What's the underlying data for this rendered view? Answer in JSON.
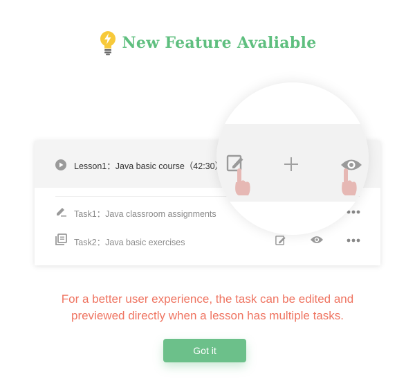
{
  "dialog": {
    "title": "New Feature Avaliable",
    "accent_color": "#5fbf7f",
    "title_icon": "lightbulb-icon"
  },
  "course": {
    "lesson": {
      "label": "Lesson1：Java basic course（42:30）",
      "icon": "play-circle-icon"
    },
    "tasks": [
      {
        "label": "Task1：Java classroom assignments",
        "icon": "edit-pen-icon"
      },
      {
        "label": "Task2：Java basic exercises",
        "icon": "library-icon"
      }
    ],
    "action_icons": [
      "edit-icon",
      "plus-icon",
      "eye-icon",
      "more-icon"
    ]
  },
  "notice": {
    "line1": "For a better user experience, the task can be edited and",
    "line2": "previewed directly when a lesson has multiple tasks.",
    "color": "#ef7461"
  },
  "button": {
    "label": "Got it",
    "color": "#6cc08a"
  }
}
